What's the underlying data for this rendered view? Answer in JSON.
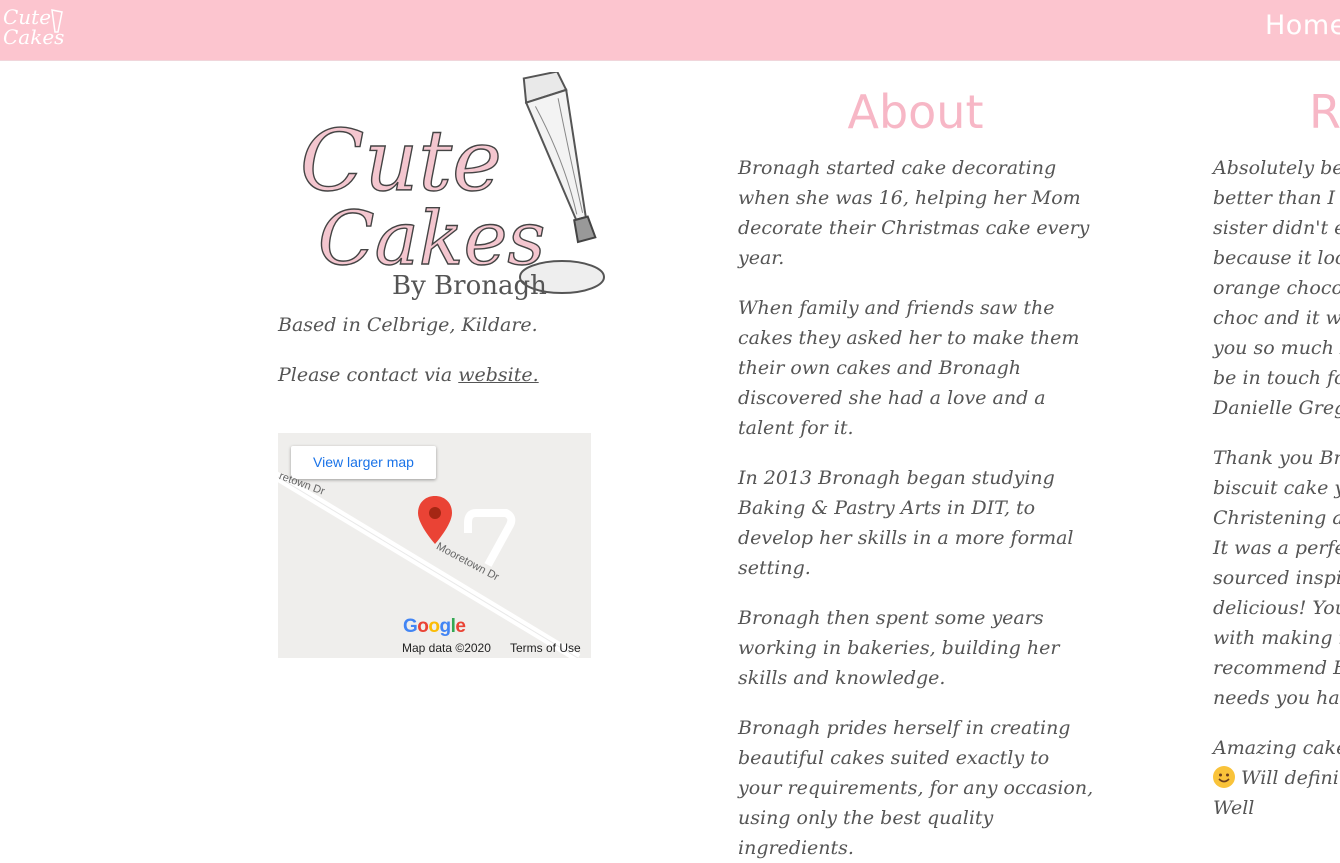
{
  "nav": {
    "home_label": "Home"
  },
  "logo_text": {
    "line1": "Cute",
    "line2": "Cakes",
    "line3": "By Bronagh"
  },
  "contact": {
    "based": "Based in Celbrige, Kildare.",
    "contact_prefix": "Please contact via ",
    "contact_link": "website."
  },
  "map": {
    "view_larger": "View larger map",
    "road1": "retown Dr",
    "road2": "Mooretown Dr",
    "map_data": "Map data ©2020",
    "terms": "Terms of Use",
    "google_letters": [
      "G",
      "o",
      "o",
      "g",
      "l",
      "e"
    ]
  },
  "about": {
    "title": "About",
    "paragraphs": [
      "Bronagh started cake decorating when she was 16, helping her Mom decorate their Christmas cake every year.",
      "When family and friends saw the cakes they asked her to make them their own cakes and Bronagh discovered she had a love and a talent for it.",
      "In 2013 Bronagh began studying Baking & Pastry Arts in DIT, to develop her skills in a more formal setting.",
      "Bronagh then spent some years working in bakeries, building her skills and knowledge.",
      "Bronagh prides herself in creating beautiful cakes suited exactly to your requirements, for any occasion, using only the best quality ingredients."
    ]
  },
  "reviews": {
    "title": "Re",
    "review1_lines": [
      "Absolutely bea",
      "better than I c",
      "sister didn't ev",
      "because it look",
      "orange chocola",
      "choc and it we",
      "you so much B",
      "be in touch for",
      "Danielle Gregg"
    ],
    "review2_lines": [
      "Thank you Bro",
      "biscuit cake yo",
      "Christening an",
      "It was a perfec",
      "sourced inspir",
      "delicious! You",
      "with making i",
      "recommend Br",
      "needs you hav"
    ],
    "review3_lines": [
      "Amazing cake.",
      "Will defini",
      "Well"
    ]
  },
  "colors": {
    "topbar": "#fcc5cf",
    "heading": "#f7b7c6",
    "text": "#555555"
  }
}
